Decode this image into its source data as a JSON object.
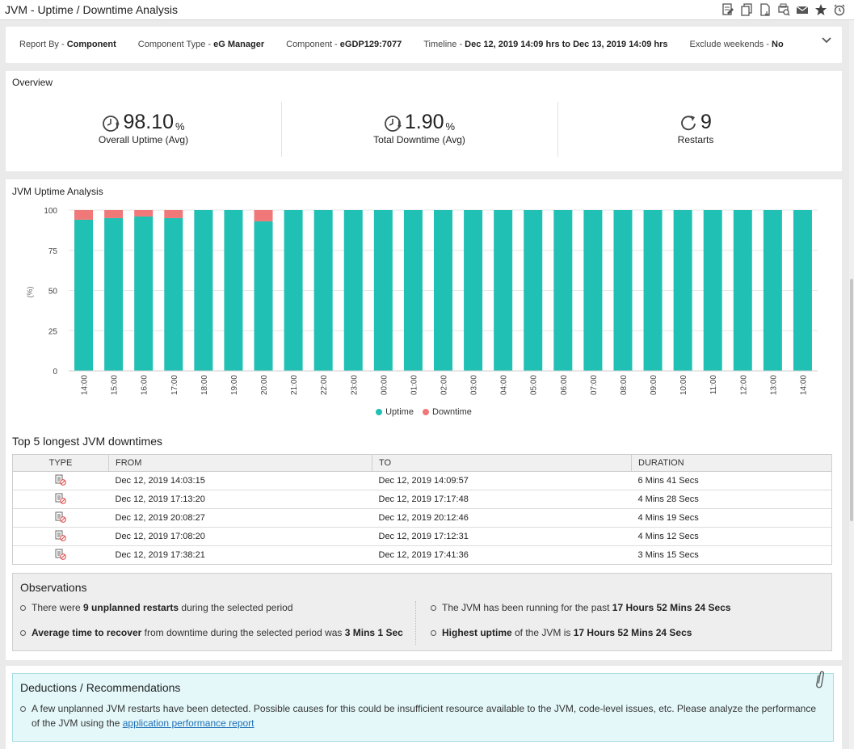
{
  "window": {
    "title": "JVM - Uptime / Downtime Analysis",
    "toolbar_icons": [
      "edit-report-icon",
      "copy-icon",
      "export-pdf-icon",
      "print-preview-icon",
      "mail-icon",
      "favorite-star-icon",
      "schedule-alarm-icon"
    ]
  },
  "filters": [
    {
      "label": "Report By - ",
      "value": "Component"
    },
    {
      "label": "Component Type - ",
      "value": "eG Manager"
    },
    {
      "label": "Component - ",
      "value": "eGDP129:7077"
    },
    {
      "label": "Timeline - ",
      "value": "Dec 12, 2019 14:09 hrs to Dec 13, 2019 14:09 hrs"
    },
    {
      "label": "Exclude weekends - ",
      "value": "No"
    }
  ],
  "overview": {
    "title": "Overview",
    "uptime": {
      "value": "98.10",
      "unit": "%",
      "label": "Overall Uptime (Avg)"
    },
    "downtime": {
      "value": "1.90",
      "unit": "%",
      "label": "Total Downtime (Avg)"
    },
    "restarts": {
      "value": "9",
      "label": "Restarts"
    }
  },
  "analysis": {
    "title": "JVM Uptime Analysis"
  },
  "chart_data": {
    "type": "bar",
    "stacked": true,
    "title": "JVM Uptime Analysis",
    "xlabel": "",
    "ylabel": "(%)",
    "ylim": [
      0,
      100
    ],
    "yticks": [
      0,
      25,
      50,
      75,
      100
    ],
    "grid": true,
    "legend_position": "bottom",
    "categories": [
      "14:00",
      "15:00",
      "16:00",
      "17:00",
      "18:00",
      "19:00",
      "20:00",
      "21:00",
      "22:00",
      "23:00",
      "00:00",
      "01:00",
      "02:00",
      "03:00",
      "04:00",
      "05:00",
      "06:00",
      "07:00",
      "08:00",
      "09:00",
      "10:00",
      "11:00",
      "12:00",
      "13:00",
      "14:00"
    ],
    "series": [
      {
        "name": "Uptime",
        "color": "#20c0b4",
        "values": [
          94,
          95,
          96,
          95,
          100,
          100,
          93,
          100,
          100,
          100,
          100,
          100,
          100,
          100,
          100,
          100,
          100,
          100,
          100,
          100,
          100,
          100,
          100,
          100,
          100
        ]
      },
      {
        "name": "Downtime",
        "color": "#f07878",
        "values": [
          6,
          5,
          4,
          5,
          0,
          0,
          7,
          0,
          0,
          0,
          0,
          0,
          0,
          0,
          0,
          0,
          0,
          0,
          0,
          0,
          0,
          0,
          0,
          0,
          0
        ]
      }
    ]
  },
  "top5": {
    "title": "Top 5 longest JVM downtimes",
    "columns": [
      "TYPE",
      "FROM",
      "TO",
      "DURATION"
    ],
    "rows": [
      {
        "type_icon": "unplanned-downtime-icon",
        "from": "Dec 12, 2019 14:03:15",
        "to": "Dec 12, 2019 14:09:57",
        "duration": "6 Mins 41 Secs"
      },
      {
        "type_icon": "unplanned-downtime-icon",
        "from": "Dec 12, 2019 17:13:20",
        "to": "Dec 12, 2019 17:17:48",
        "duration": "4 Mins 28 Secs"
      },
      {
        "type_icon": "unplanned-downtime-icon",
        "from": "Dec 12, 2019 20:08:27",
        "to": "Dec 12, 2019 20:12:46",
        "duration": "4 Mins 19 Secs"
      },
      {
        "type_icon": "unplanned-downtime-icon",
        "from": "Dec 12, 2019 17:08:20",
        "to": "Dec 12, 2019 17:12:31",
        "duration": "4 Mins 12 Secs"
      },
      {
        "type_icon": "unplanned-downtime-icon",
        "from": "Dec 12, 2019 17:38:21",
        "to": "Dec 12, 2019 17:41:36",
        "duration": "3 Mins 15 Secs"
      }
    ]
  },
  "observations": {
    "title": "Observations",
    "o1": {
      "pre": "There were ",
      "bold": "9 unplanned restarts",
      "post": " during the selected period"
    },
    "o2": {
      "bold": "Average time to recover",
      "mid": " from downtime during the selected period was ",
      "bold2": "3 Mins 1 Sec"
    },
    "o3": {
      "pre": "The JVM has been running for the past ",
      "bold": "17 Hours 52 Mins 24 Secs"
    },
    "o4": {
      "bold": "Highest uptime",
      "mid": " of the JVM is ",
      "bold2": "17 Hours 52 Mins 24 Secs"
    }
  },
  "deductions": {
    "title": "Deductions / Recommendations",
    "text": "A few unplanned JVM restarts have been detected. Possible causes for this could be insufficient resource available to the JVM, code-level issues, etc. Please analyze the performance of the JVM using the ",
    "link": "application performance report"
  },
  "colors": {
    "uptime": "#20c0b4",
    "downtime": "#f07878",
    "link": "#1f6fb5"
  }
}
